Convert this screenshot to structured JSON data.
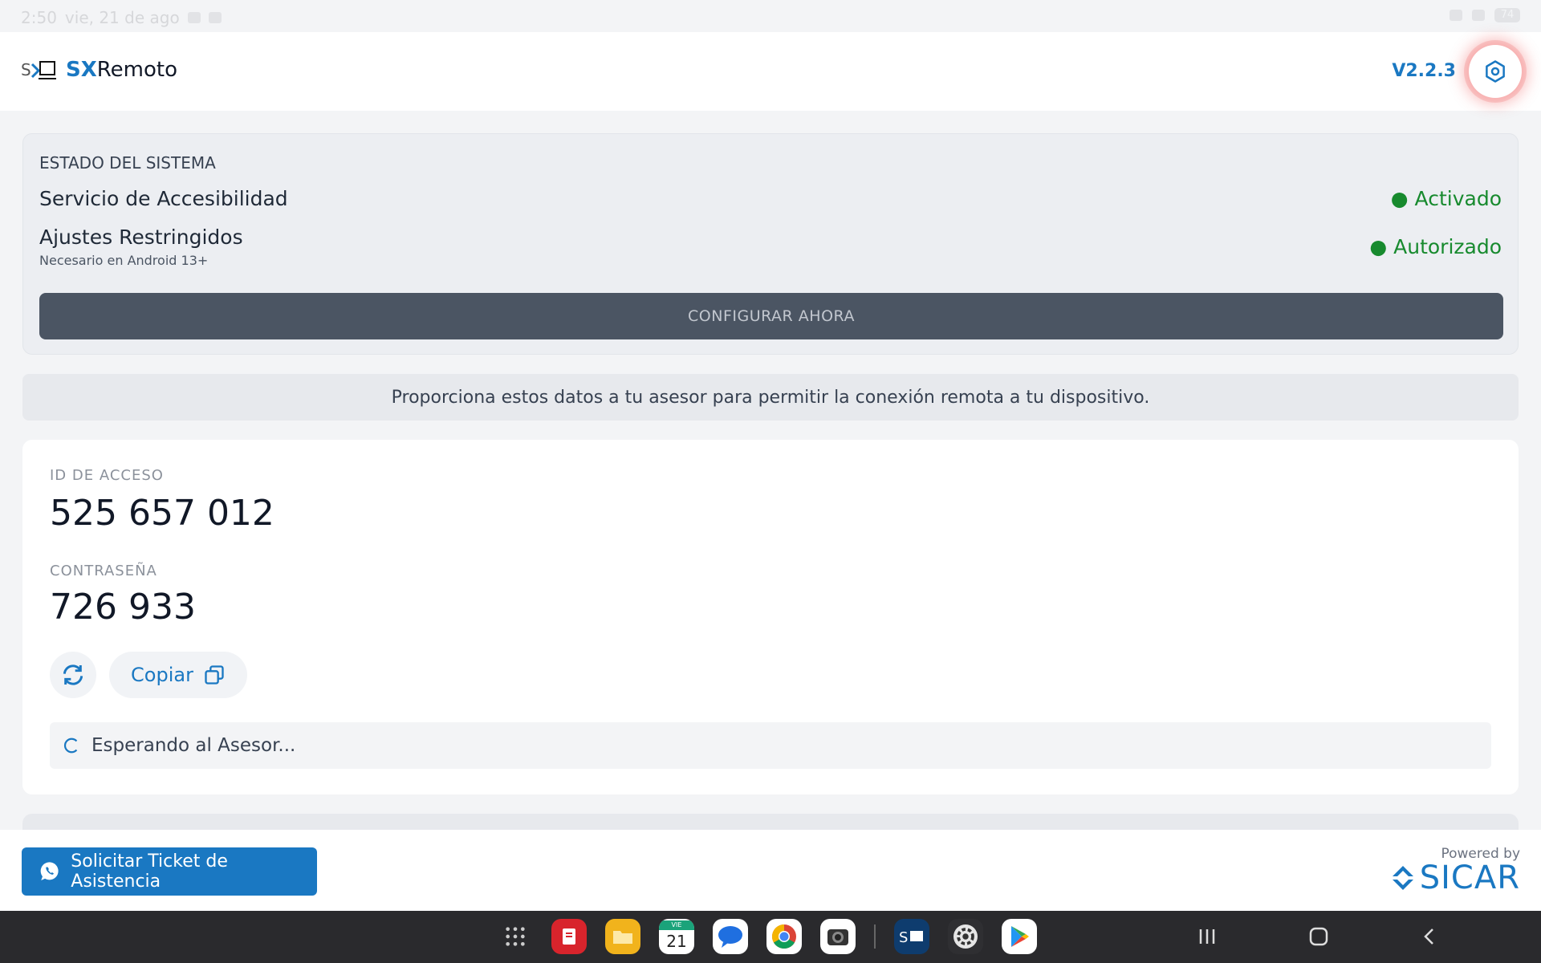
{
  "statusbar": {
    "time": "2:50",
    "date": "vie, 21 de ago",
    "battery": "74"
  },
  "header": {
    "brand_bold": "SX",
    "brand_rest": "Remoto",
    "version": "V2.2.3"
  },
  "system_status": {
    "title": "ESTADO DEL SISTEMA",
    "rows": [
      {
        "label": "Servicio de Accesibilidad",
        "value": "● Activado"
      },
      {
        "label": "Ajustes Restringidos",
        "sublabel": "Necesario en Android 13+",
        "value": "● Autorizado"
      }
    ],
    "config_button": "CONFIGURAR AHORA",
    "status_color": "#178a2e"
  },
  "info_banner": "Proporciona estos datos a tu asesor para permitir la conexión remota a tu dispositivo.",
  "credentials": {
    "id_label": "ID DE ACCESO",
    "id_value": "525 657 012",
    "password_label": "CONTRASEÑA",
    "password_value": "726 933",
    "copy_label": "Copiar",
    "waiting_text": "Esperando al Asesor..."
  },
  "footer": {
    "ticket_button": "Solicitar Ticket de Asistencia",
    "powered_by": "Powered by",
    "sicar": "SICAR"
  },
  "dock": {
    "calendar_day": "21",
    "calendar_month": "VIE"
  },
  "colors": {
    "accent": "#1a78c2",
    "success": "#178a2e",
    "button_dark": "#4b5563"
  }
}
